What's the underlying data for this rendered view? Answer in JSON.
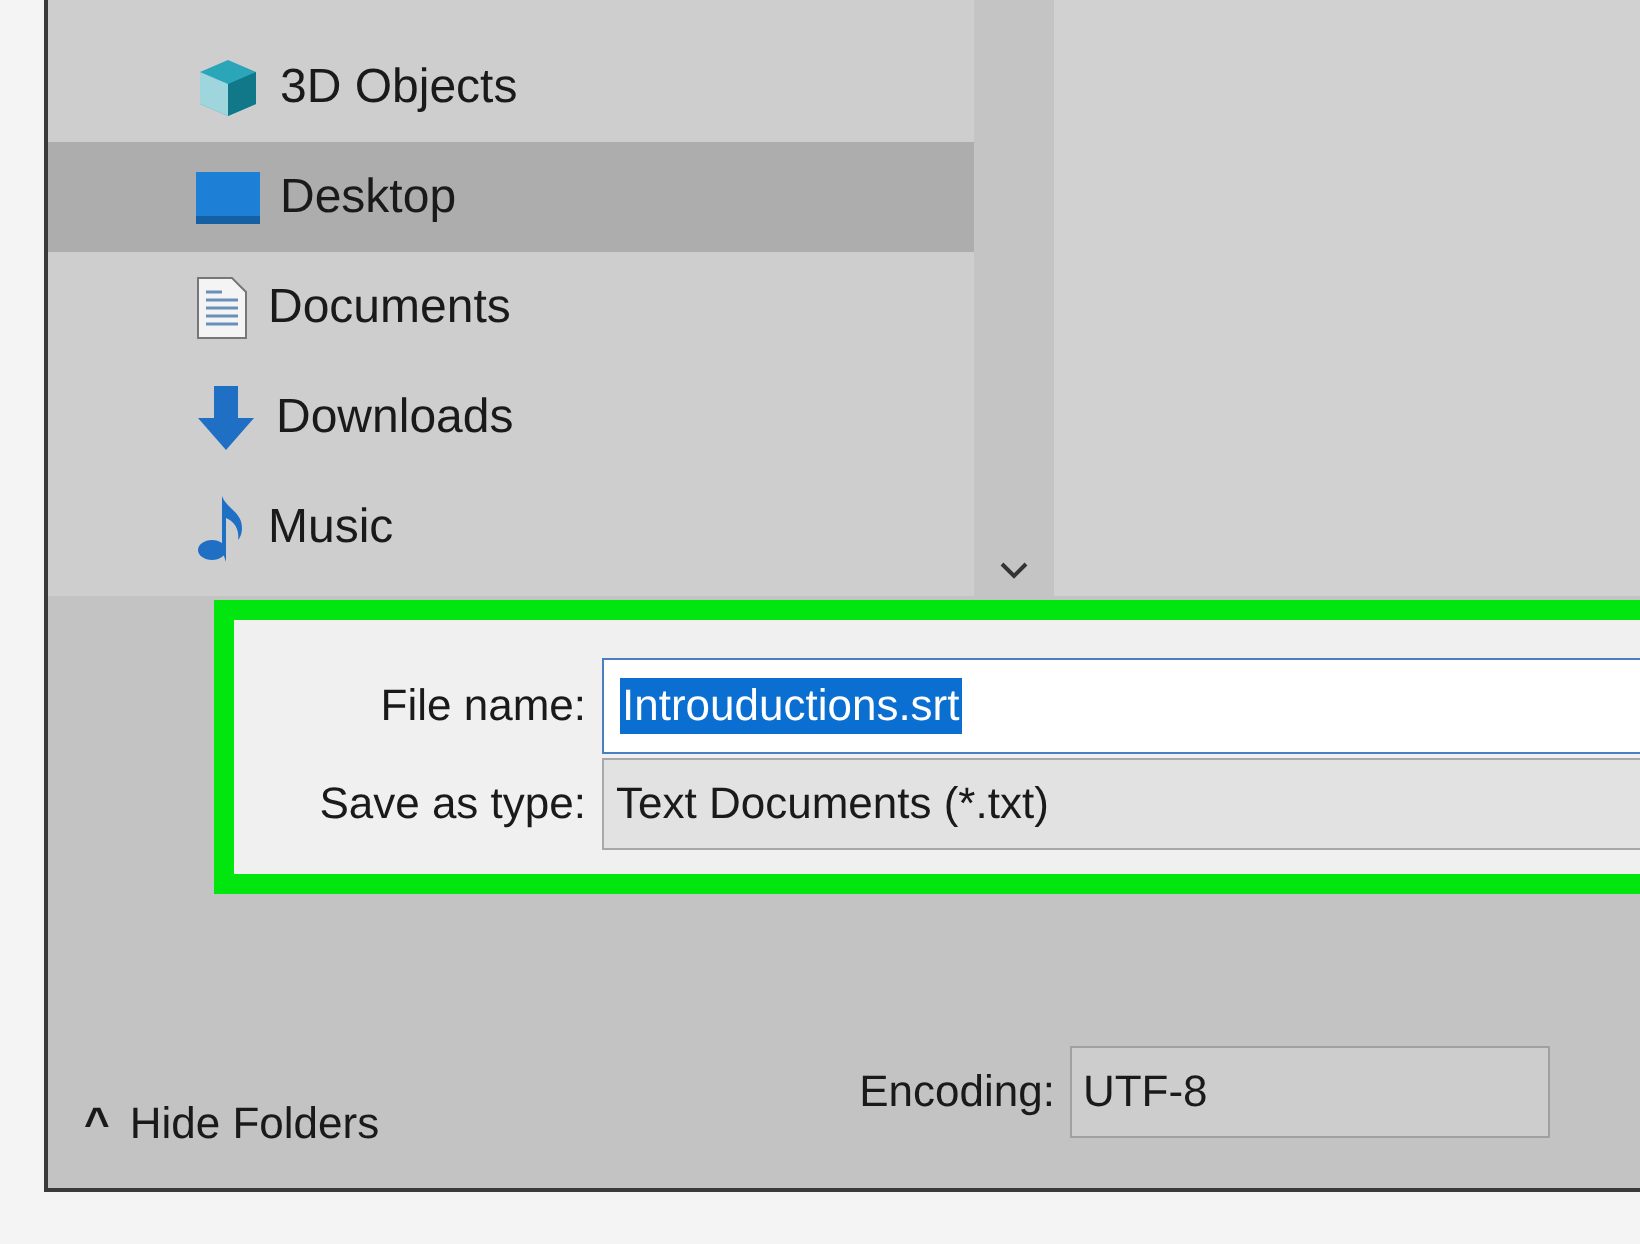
{
  "sidebar": {
    "items": [
      {
        "label": "3D Objects",
        "kind": "cube",
        "selected": false
      },
      {
        "label": "Desktop",
        "kind": "desktop",
        "selected": true
      },
      {
        "label": "Documents",
        "kind": "document",
        "selected": false
      },
      {
        "label": "Downloads",
        "kind": "download",
        "selected": false
      },
      {
        "label": "Music",
        "kind": "music",
        "selected": false
      }
    ]
  },
  "file_name": {
    "label": "File name:",
    "value": "Introuductions.srt",
    "selected": true
  },
  "save_as_type": {
    "label": "Save as type:",
    "value": "Text Documents (*.txt)"
  },
  "hide_folders": {
    "icon": "^",
    "label": "Hide Folders"
  },
  "encoding": {
    "label": "Encoding:",
    "value": "UTF-8"
  }
}
